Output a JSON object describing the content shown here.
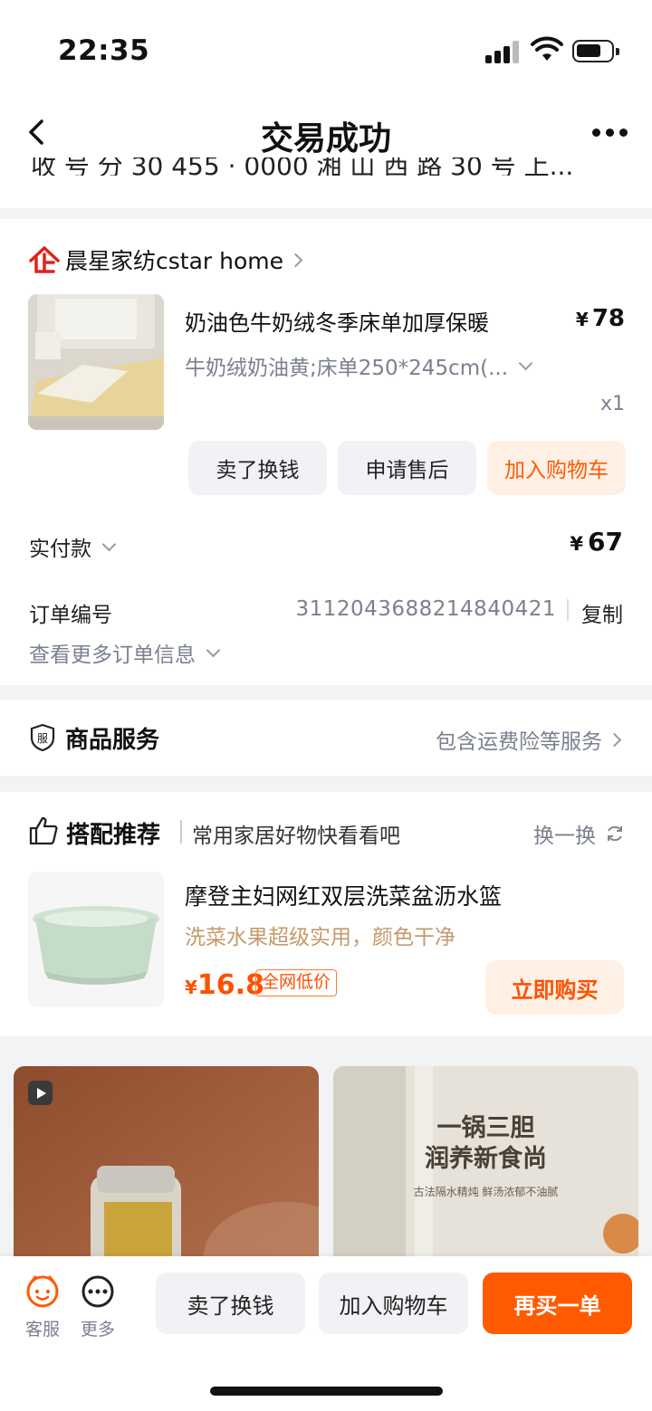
{
  "status": {
    "time": "22:35"
  },
  "nav": {
    "title": "交易成功",
    "address_partial": "收 号 分  30 455 ·   0000 湘 山 西 路 30 号 上..."
  },
  "shop": {
    "name": "晨星家纺cstar home",
    "item": {
      "name": "奶油色牛奶绒冬季床单加厚保暖",
      "price_symbol": "¥",
      "price": "78",
      "sku": "牛奶绒奶油黄;床单250*245cm(...",
      "qty": "x1"
    },
    "actions": [
      "卖了换钱",
      "申请售后",
      "加入购物车"
    ],
    "paid_label": "实付款",
    "paid_symbol": "¥",
    "paid_amount": "67",
    "order_label": "订单编号",
    "order_no": "3112043688214840421",
    "copy_label": "复制",
    "more_info": "查看更多订单信息"
  },
  "service": {
    "icon_text": "服",
    "title": "商品服务",
    "desc": "包含运费险等服务"
  },
  "reco": {
    "title": "搭配推荐",
    "subtitle": "常用家居好物快看看吧",
    "swap": "换一换",
    "item": {
      "name": "摩登主妇网红双层洗菜盆沥水篮",
      "desc": "洗菜水果超级实用，颜色干净",
      "price_symbol": "¥",
      "price": "16.8",
      "tag": "全网低价",
      "buy": "立即购买"
    }
  },
  "feed": {
    "ad_title_1": "一锅三胆",
    "ad_title_2": "润养新食尚",
    "ad_sub": "古法隔水精炖  鲜汤浓郁不油腻"
  },
  "bottom": {
    "service_label": "客服",
    "more_label": "更多",
    "sell": "卖了换钱",
    "cart": "加入购物车",
    "rebuy": "再买一单"
  },
  "colors": {
    "accent": "#ff5a00",
    "accent_bg": "#fff0e6",
    "muted": "#7b8090"
  }
}
